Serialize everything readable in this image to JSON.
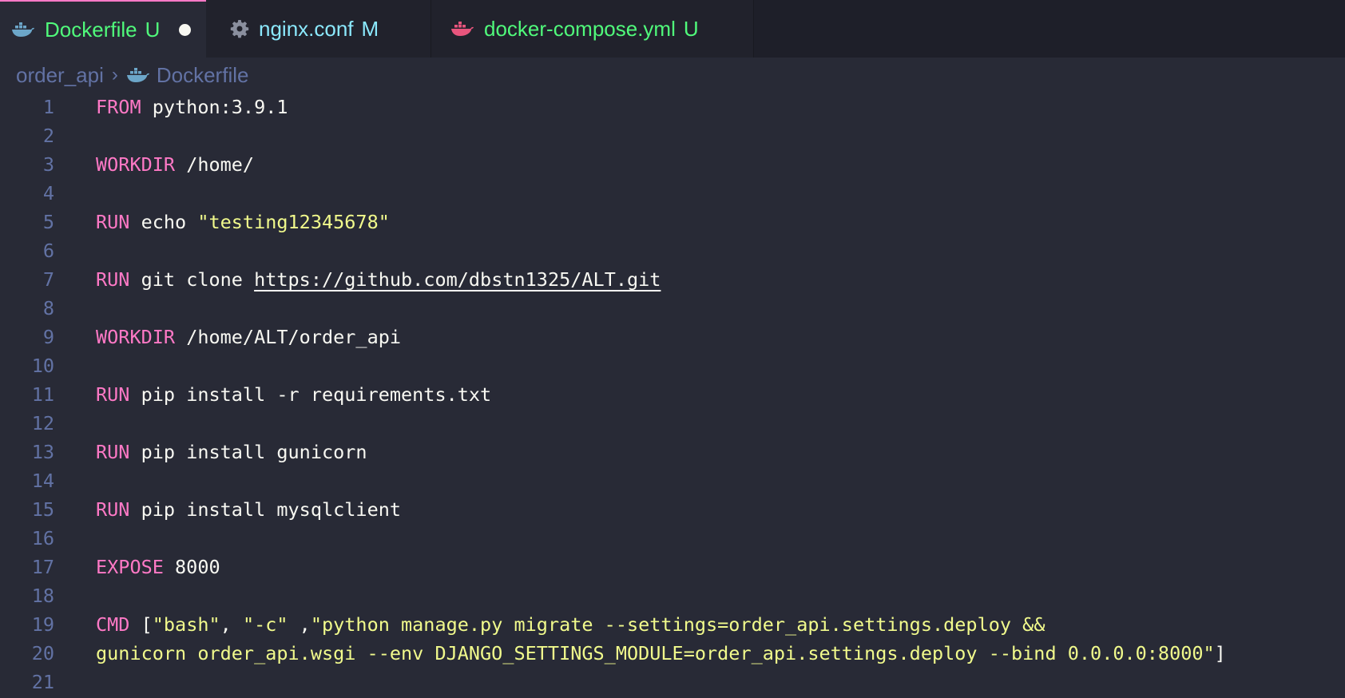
{
  "colors": {
    "background": "#282a36",
    "tabbar_background": "#1e1f29",
    "keyword": "#ff79c6",
    "string": "#f1fa8c",
    "foreground": "#f8f8f2",
    "line_number": "#6272a4",
    "untracked_green": "#50fa7b",
    "modified_cyan": "#8be9fd"
  },
  "tabs": [
    {
      "label": "Dockerfile",
      "status": "U",
      "icon": "docker-icon",
      "active": true,
      "dirty": true
    },
    {
      "label": "nginx.conf",
      "status": "M",
      "icon": "gear-icon",
      "active": false,
      "dirty": false
    },
    {
      "label": "docker-compose.yml",
      "status": "U",
      "icon": "docker-icon",
      "active": false,
      "dirty": false
    }
  ],
  "breadcrumb": {
    "folder": "order_api",
    "file": "Dockerfile",
    "file_icon": "docker-icon"
  },
  "editor": {
    "lines": [
      {
        "num": "1",
        "tokens": [
          {
            "t": "FROM",
            "c": "kw"
          },
          {
            "t": " python:3.9.1",
            "c": "plain"
          }
        ]
      },
      {
        "num": "2",
        "tokens": []
      },
      {
        "num": "3",
        "tokens": [
          {
            "t": "WORKDIR",
            "c": "kw"
          },
          {
            "t": " /home/",
            "c": "plain"
          }
        ]
      },
      {
        "num": "4",
        "tokens": []
      },
      {
        "num": "5",
        "tokens": [
          {
            "t": "RUN",
            "c": "kw"
          },
          {
            "t": " echo ",
            "c": "plain"
          },
          {
            "t": "\"testing12345678\"",
            "c": "str"
          }
        ]
      },
      {
        "num": "6",
        "tokens": []
      },
      {
        "num": "7",
        "tokens": [
          {
            "t": "RUN",
            "c": "kw"
          },
          {
            "t": " git clone ",
            "c": "plain"
          },
          {
            "t": "https://github.com/dbstn1325/ALT.git",
            "c": "url"
          }
        ]
      },
      {
        "num": "8",
        "tokens": []
      },
      {
        "num": "9",
        "tokens": [
          {
            "t": "WORKDIR",
            "c": "kw"
          },
          {
            "t": " /home/ALT/order_api",
            "c": "plain"
          }
        ]
      },
      {
        "num": "10",
        "tokens": []
      },
      {
        "num": "11",
        "tokens": [
          {
            "t": "RUN",
            "c": "kw"
          },
          {
            "t": " pip install -r requirements.txt",
            "c": "plain"
          }
        ]
      },
      {
        "num": "12",
        "tokens": []
      },
      {
        "num": "13",
        "tokens": [
          {
            "t": "RUN",
            "c": "kw"
          },
          {
            "t": " pip install gunicorn",
            "c": "plain"
          }
        ]
      },
      {
        "num": "14",
        "tokens": []
      },
      {
        "num": "15",
        "tokens": [
          {
            "t": "RUN",
            "c": "kw"
          },
          {
            "t": " pip install mysqlclient",
            "c": "plain"
          }
        ]
      },
      {
        "num": "16",
        "tokens": []
      },
      {
        "num": "17",
        "tokens": [
          {
            "t": "EXPOSE",
            "c": "kw"
          },
          {
            "t": " 8000",
            "c": "plain"
          }
        ]
      },
      {
        "num": "18",
        "tokens": []
      },
      {
        "num": "19",
        "tokens": [
          {
            "t": "CMD",
            "c": "kw"
          },
          {
            "t": " [",
            "c": "plain"
          },
          {
            "t": "\"bash\"",
            "c": "str"
          },
          {
            "t": ", ",
            "c": "plain"
          },
          {
            "t": "\"-c\"",
            "c": "str"
          },
          {
            "t": " ,",
            "c": "plain"
          },
          {
            "t": "\"python manage.py migrate --settings=order_api.settings.deploy &&",
            "c": "str"
          }
        ]
      },
      {
        "num": "20",
        "tokens": [
          {
            "t": "gunicorn order_api.wsgi --env DJANGO_SETTINGS_MODULE=order_api.settings.deploy --bind 0.0.0.0:8000\"",
            "c": "str"
          },
          {
            "t": "]",
            "c": "plain"
          }
        ]
      },
      {
        "num": "21",
        "tokens": []
      }
    ]
  }
}
